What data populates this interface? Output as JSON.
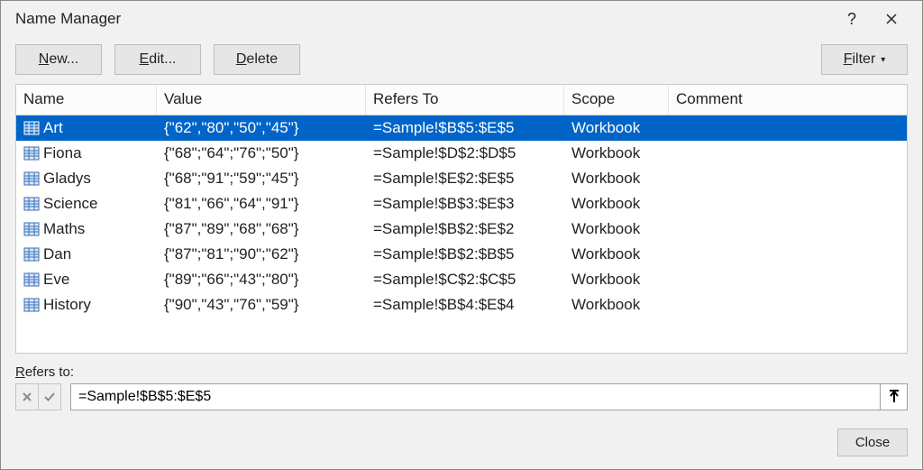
{
  "title": "Name Manager",
  "toolbar": {
    "new_label": "New...",
    "edit_label": "Edit...",
    "delete_label": "Delete",
    "filter_label": "Filter"
  },
  "columns": {
    "name": "Name",
    "value": "Value",
    "refers_to": "Refers To",
    "scope": "Scope",
    "comment": "Comment"
  },
  "rows": [
    {
      "name": "Art",
      "value": "{\"62\",\"80\",\"50\",\"45\"}",
      "refers_to": "=Sample!$B$5:$E$5",
      "scope": "Workbook",
      "comment": "",
      "selected": true
    },
    {
      "name": "Fiona",
      "value": "{\"68\";\"64\";\"76\";\"50\"}",
      "refers_to": "=Sample!$D$2:$D$5",
      "scope": "Workbook",
      "comment": "",
      "selected": false
    },
    {
      "name": "Gladys",
      "value": "{\"68\";\"91\";\"59\";\"45\"}",
      "refers_to": "=Sample!$E$2:$E$5",
      "scope": "Workbook",
      "comment": "",
      "selected": false
    },
    {
      "name": "Science",
      "value": "{\"81\",\"66\",\"64\",\"91\"}",
      "refers_to": "=Sample!$B$3:$E$3",
      "scope": "Workbook",
      "comment": "",
      "selected": false
    },
    {
      "name": "Maths",
      "value": "{\"87\",\"89\",\"68\",\"68\"}",
      "refers_to": "=Sample!$B$2:$E$2",
      "scope": "Workbook",
      "comment": "",
      "selected": false
    },
    {
      "name": "Dan",
      "value": "{\"87\";\"81\";\"90\";\"62\"}",
      "refers_to": "=Sample!$B$2:$B$5",
      "scope": "Workbook",
      "comment": "",
      "selected": false
    },
    {
      "name": "Eve",
      "value": "{\"89\";\"66\";\"43\";\"80\"}",
      "refers_to": "=Sample!$C$2:$C$5",
      "scope": "Workbook",
      "comment": "",
      "selected": false
    },
    {
      "name": "History",
      "value": "{\"90\",\"43\",\"76\",\"59\"}",
      "refers_to": "=Sample!$B$4:$E$4",
      "scope": "Workbook",
      "comment": "",
      "selected": false
    }
  ],
  "refers_section": {
    "label": "Refers to:",
    "value": "=Sample!$B$5:$E$5"
  },
  "footer": {
    "close_label": "Close"
  }
}
